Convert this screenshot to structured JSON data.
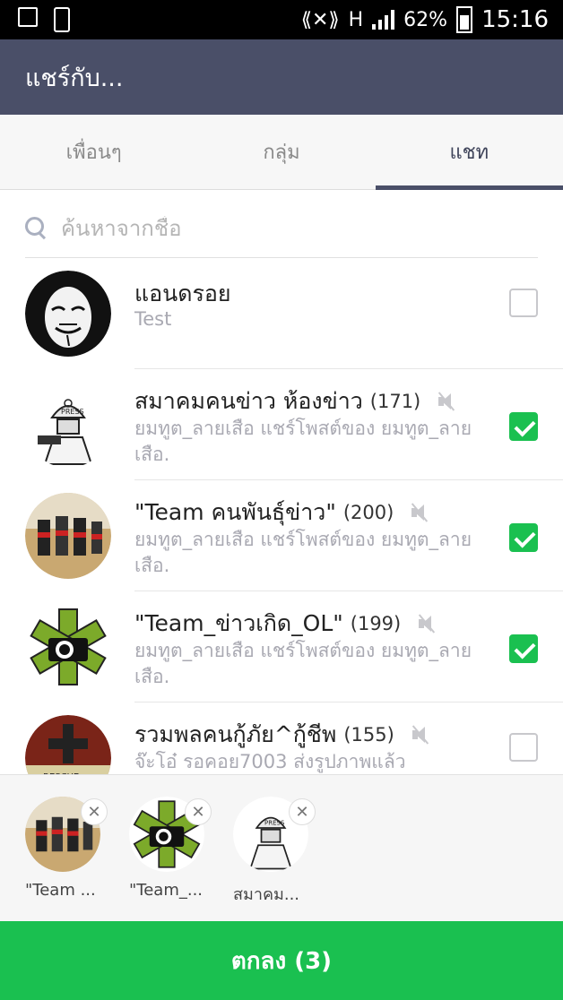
{
  "status_bar": {
    "battery": "62%",
    "time": "15:16",
    "network": "H"
  },
  "app_bar": {
    "title": "แชร์กับ..."
  },
  "tabs": [
    {
      "label": "เพื่อนๆ",
      "active": false
    },
    {
      "label": "กลุ่ม",
      "active": false
    },
    {
      "label": "แชท",
      "active": true
    }
  ],
  "search": {
    "placeholder": "ค้นหาจากชื่อ",
    "value": ""
  },
  "chats": [
    {
      "title": "แอนดรอย",
      "count": "",
      "muted": false,
      "subtitle": "Test",
      "checked": false,
      "avatar": "anonymous-mask-avatar"
    },
    {
      "title": "สมาคมคนข่าว ห้องข่าว",
      "count": "(171)",
      "muted": true,
      "subtitle": "ยมทูต_ลายเสือ แชร์โพสต์ของ ยมทูต_ลายเสือ.",
      "checked": true,
      "avatar": "press-soldier-avatar"
    },
    {
      "title": "\"Team คนพันธุ์ข่าว\"",
      "count": "(200)",
      "muted": true,
      "subtitle": "ยมทูต_ลายเสือ แชร์โพสต์ของ ยมทูต_ลายเสือ.",
      "checked": true,
      "avatar": "microphones-avatar"
    },
    {
      "title": "\"Team_ข่าวเกิด_OL\"",
      "count": "(199)",
      "muted": true,
      "subtitle": "ยมทูต_ลายเสือ แชร์โพสต์ของ ยมทูต_ลายเสือ.",
      "checked": true,
      "avatar": "camera-star-avatar"
    },
    {
      "title": "รวมพลคนกู้ภัย^กู้ชีพ",
      "count": "(155)",
      "muted": true,
      "subtitle": "จ๊ะโอ๋ รอคอย7003 ส่งรูปภาพแล้ว",
      "checked": false,
      "avatar": "rescue-avatar"
    }
  ],
  "selected": [
    {
      "label": "\"Team ...",
      "avatar": "microphones-avatar"
    },
    {
      "label": "\"Team_...",
      "avatar": "camera-star-avatar"
    },
    {
      "label": "สมาคม...",
      "avatar": "press-soldier-avatar"
    }
  ],
  "ok_button": {
    "label": "ตกลง (3)"
  },
  "colors": {
    "header": "#4a4f68",
    "accent_green": "#1ac050"
  }
}
